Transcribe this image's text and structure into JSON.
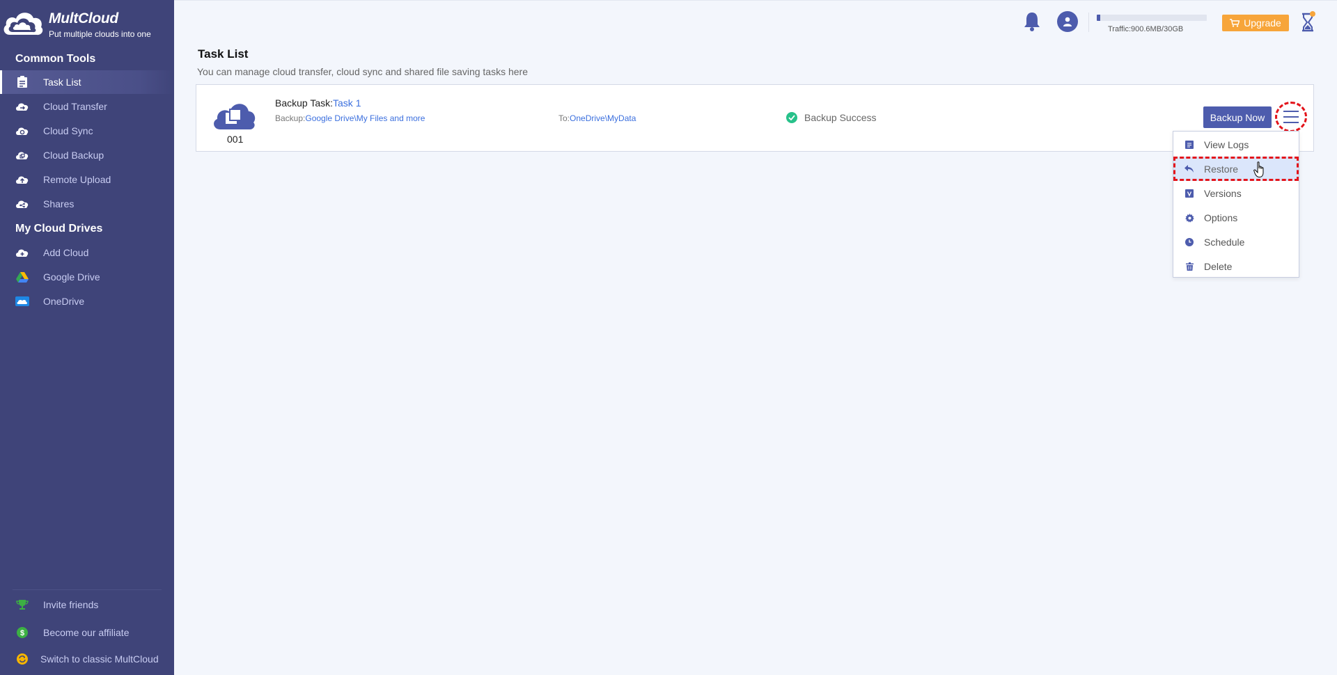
{
  "brand": {
    "name": "MultCloud",
    "slogan": "Put multiple clouds into one"
  },
  "sidebar": {
    "common_tools_title": "Common Tools",
    "common_tools": [
      {
        "label": "Task List",
        "icon": "task-list-icon",
        "active": true
      },
      {
        "label": "Cloud Transfer",
        "icon": "cloud-transfer-icon"
      },
      {
        "label": "Cloud Sync",
        "icon": "cloud-sync-icon"
      },
      {
        "label": "Cloud Backup",
        "icon": "cloud-backup-icon"
      },
      {
        "label": "Remote Upload",
        "icon": "remote-upload-icon"
      },
      {
        "label": "Shares",
        "icon": "shares-icon"
      }
    ],
    "my_drives_title": "My Cloud Drives",
    "my_drives": [
      {
        "label": "Add Cloud",
        "icon": "add-cloud-icon"
      },
      {
        "label": "Google Drive",
        "icon": "google-drive-icon"
      },
      {
        "label": "OneDrive",
        "icon": "onedrive-icon"
      }
    ],
    "footer": [
      {
        "label": "Invite friends",
        "icon": "trophy-icon"
      },
      {
        "label": "Become our affiliate",
        "icon": "dollar-icon"
      },
      {
        "label": "Switch to classic MultCloud",
        "icon": "switch-icon"
      }
    ]
  },
  "topbar": {
    "traffic_text": "Traffic:900.6MB/30GB",
    "traffic_used_fraction": 0.03,
    "upgrade_label": "Upgrade"
  },
  "main": {
    "title": "Task List",
    "subtitle": "You can manage cloud transfer, cloud sync and shared file saving tasks here"
  },
  "task": {
    "number": "001",
    "type_label": "Backup Task:",
    "name": "Task 1",
    "backup_label": "Backup:",
    "backup_source": "Google Drive\\My Files and more",
    "to_label": "To:",
    "destination": "OneDrive\\MyData",
    "status": "Backup Success",
    "backup_now_label": "Backup Now"
  },
  "dropdown": {
    "items": [
      {
        "label": "View Logs",
        "icon": "logs-icon"
      },
      {
        "label": "Restore",
        "icon": "restore-icon",
        "highlighted": true
      },
      {
        "label": "Versions",
        "icon": "versions-icon"
      },
      {
        "label": "Options",
        "icon": "gear-icon"
      },
      {
        "label": "Schedule",
        "icon": "clock-icon"
      },
      {
        "label": "Delete",
        "icon": "trash-icon"
      }
    ]
  },
  "colors": {
    "sidebar_bg": "#3f4479",
    "accent": "#4d5cad",
    "upgrade": "#f7a53a",
    "success": "#27c18a",
    "link": "#3b6fde",
    "highlight_border": "#e3141b"
  }
}
